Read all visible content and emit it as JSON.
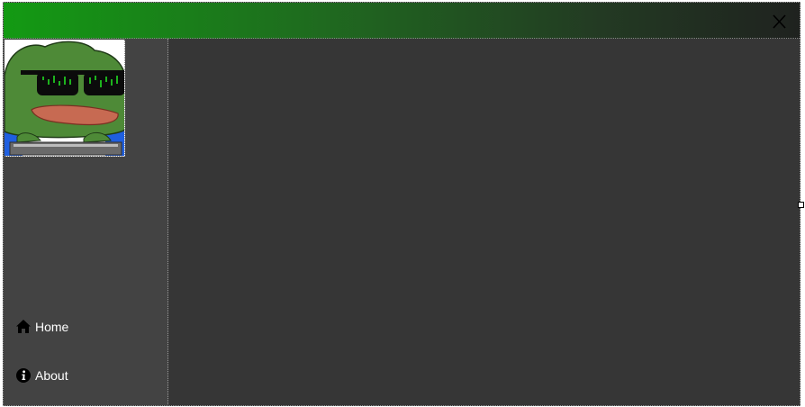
{
  "titlebar": {
    "close_label": "X"
  },
  "sidebar": {
    "items": [
      {
        "label": "Home",
        "icon": "home-icon"
      },
      {
        "label": "About",
        "icon": "info-icon"
      }
    ]
  },
  "colors": {
    "titlebar_gradient_start": "#139a13",
    "titlebar_gradient_end": "#1f221f",
    "sidebar_bg": "#434343",
    "main_bg": "#363636",
    "text": "#ffffff"
  }
}
